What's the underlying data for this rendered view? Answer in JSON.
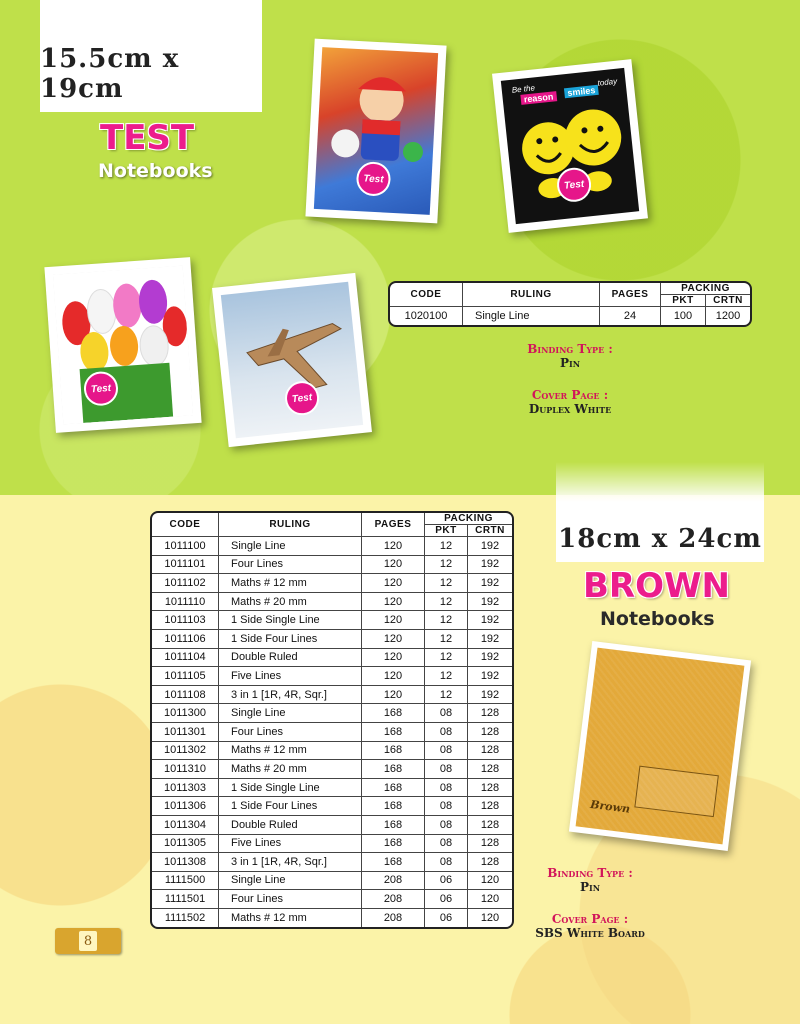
{
  "test_section": {
    "size": "15.5cm x 19cm",
    "title": "TEST",
    "subtitle": "Notebooks",
    "covers": [
      {
        "name": "mario-cover"
      },
      {
        "name": "smiley-cover",
        "slogan1": "Be the",
        "slogan2": "reason",
        "slogan3": "smiles",
        "slogan4": "today"
      },
      {
        "name": "tulips-cover"
      },
      {
        "name": "jet-cover"
      }
    ],
    "table": {
      "headers": {
        "code": "CODE",
        "ruling": "RULING",
        "pages": "PAGES",
        "packing": "PACKING",
        "pkt": "PKT",
        "crtn": "CRTN"
      },
      "rows": [
        {
          "code": "1020100",
          "ruling": "Single Line",
          "pages": "24",
          "pkt": "100",
          "crtn": "1200"
        }
      ]
    },
    "binding_label": "Binding Type :",
    "binding_value": "Pin",
    "cover_label": "Cover Page :",
    "cover_value": "Duplex White"
  },
  "brown_section": {
    "size": "18cm x 24cm",
    "title": "BROWN",
    "subtitle": "Notebooks",
    "table": {
      "headers": {
        "code": "CODE",
        "ruling": "RULING",
        "pages": "PAGES",
        "packing": "PACKING",
        "pkt": "PKT",
        "crtn": "CRTN"
      },
      "rows": [
        {
          "code": "1011100",
          "ruling": "Single Line",
          "pages": "120",
          "pkt": "12",
          "crtn": "192"
        },
        {
          "code": "1011101",
          "ruling": "Four Lines",
          "pages": "120",
          "pkt": "12",
          "crtn": "192"
        },
        {
          "code": "1011102",
          "ruling": "Maths # 12 mm",
          "pages": "120",
          "pkt": "12",
          "crtn": "192"
        },
        {
          "code": "1011110",
          "ruling": "Maths # 20 mm",
          "pages": "120",
          "pkt": "12",
          "crtn": "192"
        },
        {
          "code": "1011103",
          "ruling": "1 Side Single Line",
          "pages": "120",
          "pkt": "12",
          "crtn": "192"
        },
        {
          "code": "1011106",
          "ruling": "1 Side Four Lines",
          "pages": "120",
          "pkt": "12",
          "crtn": "192"
        },
        {
          "code": "1011104",
          "ruling": "Double Ruled",
          "pages": "120",
          "pkt": "12",
          "crtn": "192"
        },
        {
          "code": "1011105",
          "ruling": "Five Lines",
          "pages": "120",
          "pkt": "12",
          "crtn": "192"
        },
        {
          "code": "1011108",
          "ruling": "3 in 1 [1R, 4R, Sqr.]",
          "pages": "120",
          "pkt": "12",
          "crtn": "192"
        },
        {
          "code": "1011300",
          "ruling": "Single Line",
          "pages": "168",
          "pkt": "08",
          "crtn": "128"
        },
        {
          "code": "1011301",
          "ruling": "Four Lines",
          "pages": "168",
          "pkt": "08",
          "crtn": "128"
        },
        {
          "code": "1011302",
          "ruling": "Maths # 12 mm",
          "pages": "168",
          "pkt": "08",
          "crtn": "128"
        },
        {
          "code": "1011310",
          "ruling": "Maths # 20 mm",
          "pages": "168",
          "pkt": "08",
          "crtn": "128"
        },
        {
          "code": "1011303",
          "ruling": "1 Side Single Line",
          "pages": "168",
          "pkt": "08",
          "crtn": "128"
        },
        {
          "code": "1011306",
          "ruling": "1 Side Four Lines",
          "pages": "168",
          "pkt": "08",
          "crtn": "128"
        },
        {
          "code": "1011304",
          "ruling": "Double Ruled",
          "pages": "168",
          "pkt": "08",
          "crtn": "128"
        },
        {
          "code": "1011305",
          "ruling": "Five Lines",
          "pages": "168",
          "pkt": "08",
          "crtn": "128"
        },
        {
          "code": "1011308",
          "ruling": "3 in 1 [1R, 4R, Sqr.]",
          "pages": "168",
          "pkt": "08",
          "crtn": "128"
        },
        {
          "code": "1111500",
          "ruling": "Single Line",
          "pages": "208",
          "pkt": "06",
          "crtn": "120"
        },
        {
          "code": "1111501",
          "ruling": "Four Lines",
          "pages": "208",
          "pkt": "06",
          "crtn": "120"
        },
        {
          "code": "1111502",
          "ruling": "Maths # 12 mm",
          "pages": "208",
          "pkt": "06",
          "crtn": "120"
        }
      ]
    },
    "cover_script": "Brown",
    "binding_label": "Binding Type :",
    "binding_value": "Pin",
    "cover_label": "Cover Page :",
    "cover_value": "SBS White Board"
  },
  "page_number": "8",
  "colors": {
    "top_bg": "#bfe04a",
    "bottom_bg": "#fbf3a8",
    "accent_pink": "#ec1c8c",
    "label_red": "#d2145a"
  }
}
